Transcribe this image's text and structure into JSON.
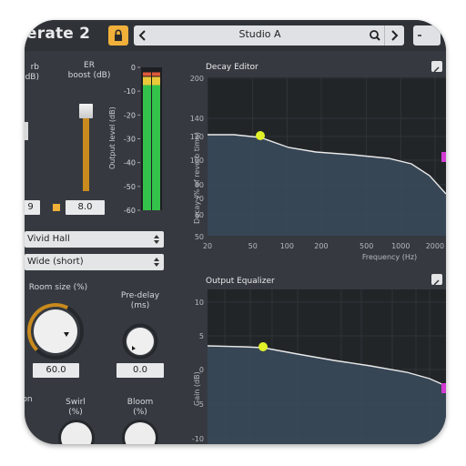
{
  "window": {
    "title": "erate 2"
  },
  "preset": {
    "name": "Studio A"
  },
  "reverb_col": {
    "label": "rb\ndB)",
    "value": "9"
  },
  "er_boost": {
    "label": "ER\nboost (dB)",
    "value": "8.0",
    "level": 0.73
  },
  "output_meter": {
    "axis_label": "Output level (dB)",
    "ticks": [
      "0",
      "-10",
      "-20",
      "-30",
      "-40",
      "-50",
      "-60"
    ],
    "left_level_db": -4,
    "right_level_db": -4
  },
  "space_dropdown": {
    "value": "Vivid Hall"
  },
  "size_dropdown": {
    "value": "Wide (short)"
  },
  "room_size": {
    "label": "Room size (%)",
    "value": "60.0"
  },
  "pre_delay": {
    "label": "Pre-delay\n(ms)",
    "value": "0.0"
  },
  "row3": {
    "cut_label": "on",
    "swirl_label": "Swirl\n(%)",
    "bloom_label": "Bloom\n(%)"
  },
  "decay_editor": {
    "title": "Decay Editor",
    "y_label": "Decay (% of reverb time)",
    "y_ticks": [
      "200",
      "140",
      "120",
      "100",
      "80",
      "70",
      "60",
      "50"
    ],
    "x_label": "Frequency (Hz)",
    "x_ticks": [
      "20",
      "50",
      "100",
      "200",
      "500",
      "1000",
      "2000"
    ]
  },
  "output_eq": {
    "title": "Output Equalizer",
    "y_label": "Gain (dB)",
    "y_ticks": [
      "10",
      "5",
      "0",
      "-5",
      "-10"
    ]
  },
  "colors": {
    "accent": "#f0b03a",
    "handle_yellow": "#e2f22a",
    "handle_magenta": "#d23bd2",
    "meter_green": "#35c24a"
  }
}
